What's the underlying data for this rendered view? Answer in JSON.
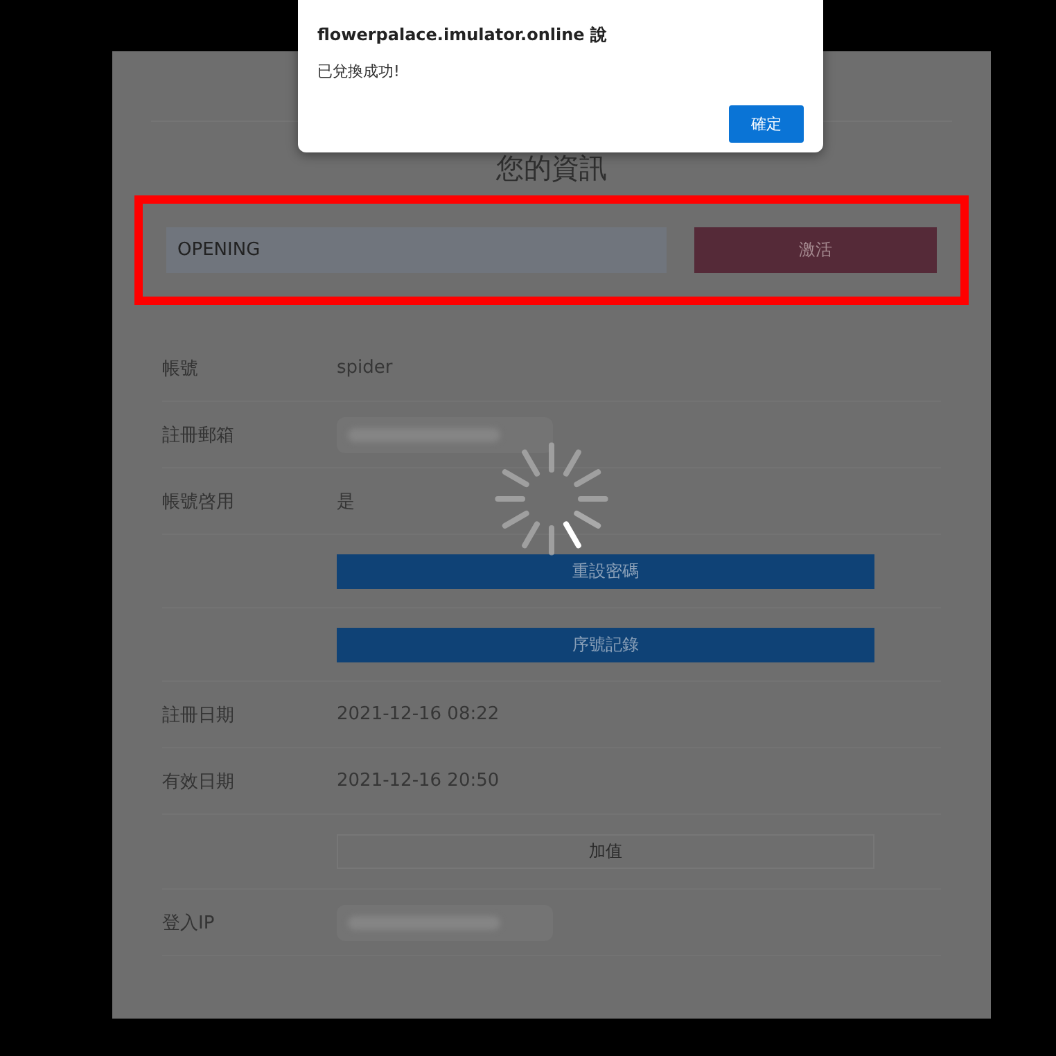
{
  "dialog": {
    "title": "flowerpalace.imulator.online 說",
    "message": "已兌換成功!",
    "button": "確定"
  },
  "page": {
    "heading": "您的資訊",
    "highlighted": true,
    "code_field": {
      "value": "OPENING"
    },
    "activate_button": "激活",
    "rows": [
      {
        "kind": "field",
        "label": "帳號",
        "value": "spider"
      },
      {
        "kind": "redacted",
        "label": "註冊郵箱"
      },
      {
        "kind": "field",
        "label": "帳號啓用",
        "value": "是"
      },
      {
        "kind": "primary_action",
        "button": "重設密碼"
      },
      {
        "kind": "primary_action",
        "button": "序號記錄"
      },
      {
        "kind": "field",
        "label": "註冊日期",
        "value": "2021-12-16 08:22"
      },
      {
        "kind": "field",
        "label": "有效日期",
        "value": "2021-12-16 20:50"
      },
      {
        "kind": "outline_action",
        "button": "加值"
      },
      {
        "kind": "redacted",
        "label": "登入IP"
      }
    ]
  },
  "loading": true
}
